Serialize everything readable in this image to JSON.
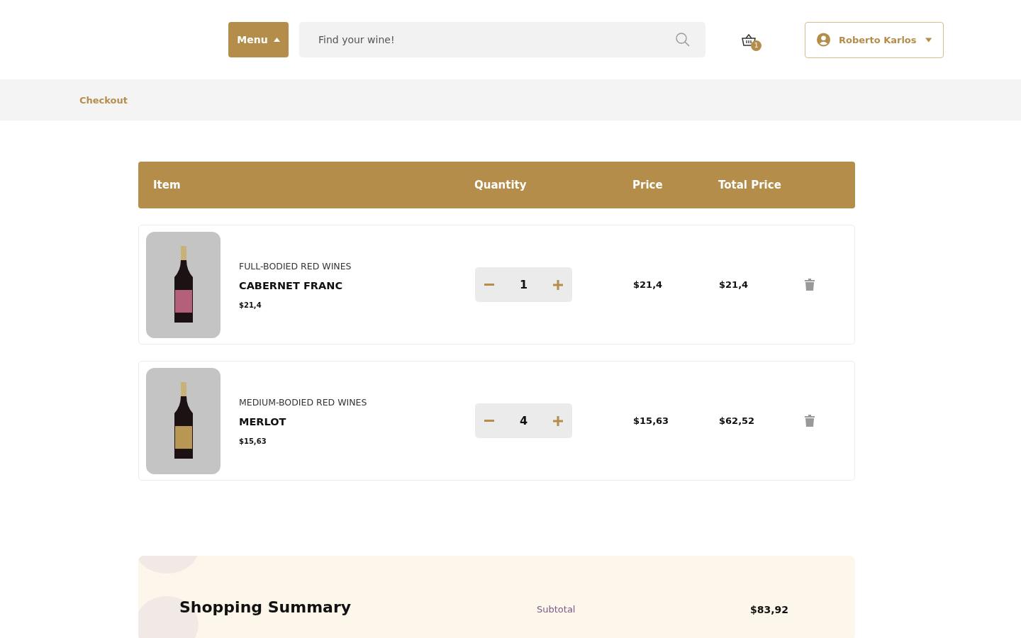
{
  "header": {
    "menu_button": "Menu",
    "search": {
      "placeholder": "Find your wine!"
    },
    "cart_count": "1",
    "user": "Roberto Karlos"
  },
  "breadcrumb": "Checkout",
  "table": {
    "columns": [
      "Item",
      "Quantity",
      "Price",
      "Total Price"
    ],
    "rows": [
      {
        "category": "FULL-BODIED RED WINES",
        "name": "CABERNET FRANC",
        "unit_price": "$21,4",
        "quantity": "1",
        "price": "$21,4",
        "total": "$21,4"
      },
      {
        "category": "MEDIUM-BODIED RED WINES",
        "name": "MERLOT",
        "unit_price": "$15,63",
        "quantity": "4",
        "price": "$15,63",
        "total": "$62,52"
      }
    ]
  },
  "summary": {
    "title": "Shopping Summary",
    "lines": [
      {
        "label": "Subtotal",
        "value": "$83,92"
      }
    ]
  }
}
